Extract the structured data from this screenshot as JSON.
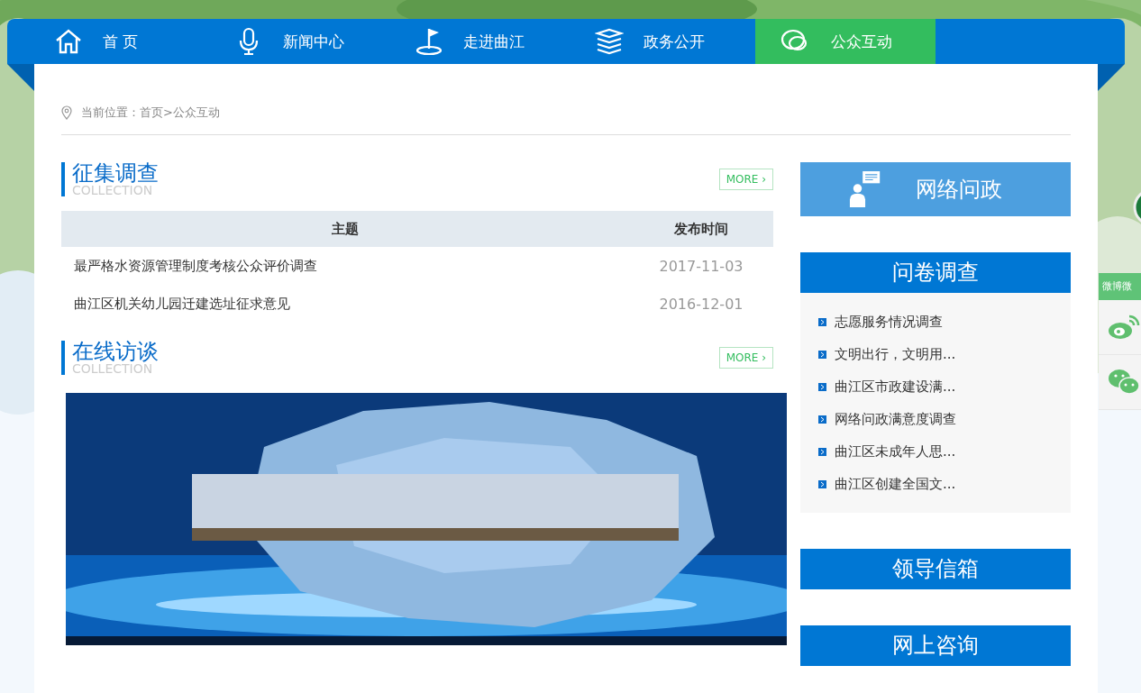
{
  "nav": [
    {
      "label": "首 页",
      "selected": false
    },
    {
      "label": "新闻中心",
      "selected": false
    },
    {
      "label": "走进曲江",
      "selected": false
    },
    {
      "label": "政务公开",
      "selected": false
    },
    {
      "label": "公众互动",
      "selected": true
    }
  ],
  "breadcrumb": "当前位置：首页>公众互动",
  "survey": {
    "title": "征集调查",
    "subtitle": "COLLECTION",
    "more": "MORE ›",
    "columns": [
      "主题",
      "发布时间"
    ],
    "rows": [
      {
        "topic": "最严格水资源管理制度考核公众评价调查",
        "date": "2017-11-03"
      },
      {
        "topic": "曲江区机关幼儿园迁建选址征求意见",
        "date": "2016-12-01"
      }
    ]
  },
  "interview": {
    "title": "在线访谈",
    "subtitle": "COLLECTION",
    "more": "MORE ›"
  },
  "sidebar": {
    "online": "网络问政",
    "questionnaire": {
      "title": "问卷调查",
      "items": [
        "志愿服务情况调查",
        "文明出行，文明用...",
        "曲江区市政建设满...",
        "网络问政满意度调查",
        "曲江区未成年人思...",
        "曲江区创建全国文..."
      ]
    },
    "mailbox": "领导信箱",
    "consult": "网上咨询"
  },
  "float_panel": {
    "title": "微博微"
  }
}
